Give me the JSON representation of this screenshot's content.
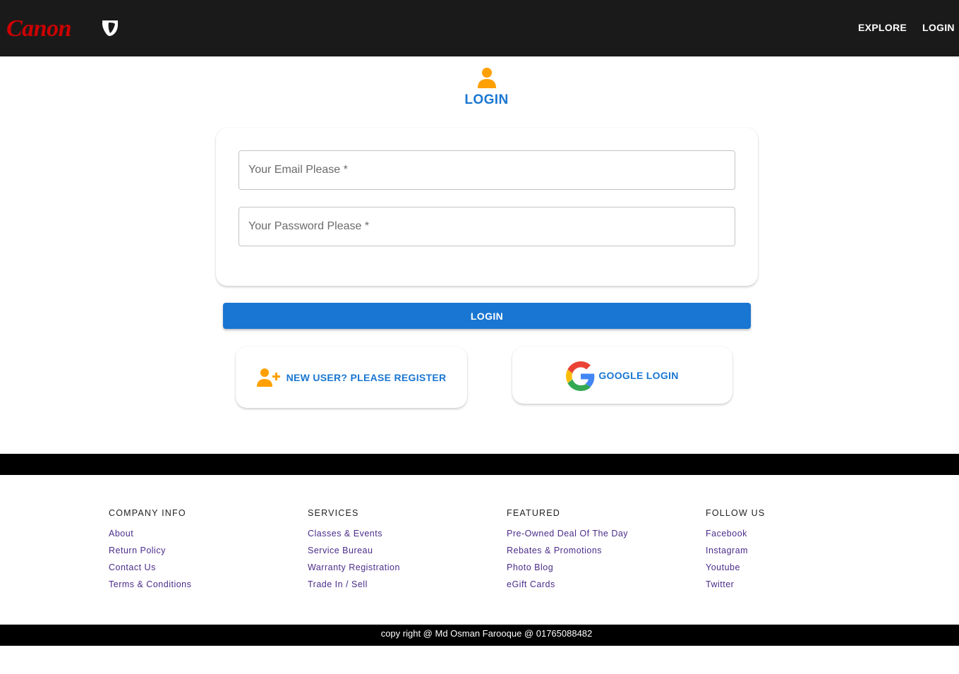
{
  "header": {
    "logo_text": "Canon",
    "nav": [
      "EXPLORE",
      "LOGIN"
    ]
  },
  "login": {
    "title": "LOGIN",
    "email_placeholder": "Your Email Please *",
    "password_placeholder": "Your Password Please *",
    "submit_label": "LOGIN",
    "register_label": "NEW USER? PLEASE REGISTER",
    "google_label": "GOOGLE LOGIN"
  },
  "footer": {
    "columns": [
      {
        "heading": "COMPANY INFO",
        "links": [
          "About",
          "Return Policy",
          "Contact Us",
          "Terms & Conditions"
        ]
      },
      {
        "heading": "SERVICES",
        "links": [
          "Classes & Events",
          "Service Bureau",
          "Warranty Registration",
          "Trade In / Sell"
        ]
      },
      {
        "heading": "FEATURED",
        "links": [
          "Pre-Owned Deal Of The Day",
          "Rebates & Promotions",
          "Photo Blog",
          "eGift Cards"
        ]
      },
      {
        "heading": "FOLLOW US",
        "links": [
          "Facebook",
          "Instagram",
          "Youtube",
          "Twitter"
        ]
      }
    ],
    "copyright": "copy right @ Md Osman Farooque @ 01765088482"
  },
  "colors": {
    "header_bg": "#1b1a1a",
    "brand_red": "#cc0000",
    "accent_blue": "#1976d2",
    "icon_orange": "#ffa000",
    "footer_link": "#4b2c8a"
  },
  "icons": {
    "user": "person-icon",
    "register": "person-add-icon",
    "google": "google-icon",
    "logo_mark": "typo3-icon"
  }
}
